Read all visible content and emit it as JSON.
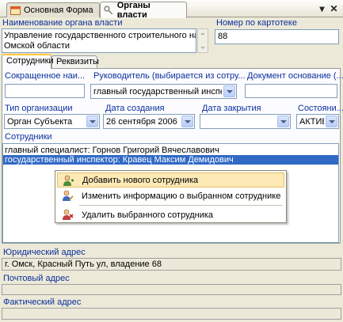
{
  "tabs": [
    {
      "label": "Основная Форма",
      "active": false
    },
    {
      "label": "Органы власти",
      "active": true
    }
  ],
  "window_controls": {
    "dropdown": "▾",
    "close": "✕"
  },
  "org_name": {
    "label": "Наименование органа власти",
    "value_line1": "Управление государственного строительного надзора",
    "value_line2": "Омской области"
  },
  "card_number": {
    "label": "Номер по картотеке",
    "value": "88"
  },
  "inner_tabs": [
    {
      "label": "Сотрудники",
      "active": true
    },
    {
      "label": "Реквизиты",
      "active": false
    }
  ],
  "fields": {
    "short_name": {
      "label": "Сокращенное наи...",
      "value": ""
    },
    "head": {
      "label": "Руководитель  (выбирается  из  сотру...",
      "value": "главный государственный инспекто"
    },
    "document": {
      "label": "Документ  основание (...",
      "value": ""
    },
    "org_type": {
      "label": "Тип организации",
      "value": "Орган Субъекта"
    },
    "created": {
      "label": "Дата создания",
      "value": "26 сентября 2006"
    },
    "closed": {
      "label": "Дата закрытия",
      "value": ""
    },
    "state": {
      "label": "Состояни...",
      "value": "АКТИВІ"
    }
  },
  "employees": {
    "label": "Сотрудники",
    "rows": [
      {
        "text": "главный специалист:  Горнов Григорий Вячеславович",
        "selected": false
      },
      {
        "text": "государственный инспектор:  Кравец Максим Демидович",
        "selected": true
      }
    ]
  },
  "context_menu": {
    "items": [
      {
        "label": "Добавить нового сотрудника",
        "highlighted": true,
        "icon": "add-user-icon"
      },
      {
        "label": "Изменить информацию о выбранном сотруднике",
        "highlighted": false,
        "icon": "edit-user-icon"
      },
      {
        "label": "Удалить выбранного сотрудника",
        "highlighted": false,
        "icon": "delete-user-icon"
      }
    ]
  },
  "addresses": {
    "legal": {
      "label": "Юридический адрес",
      "value": "г. Омск, Красный Путь ул, владение 68"
    },
    "postal": {
      "label": "Почтовый адрес",
      "value": ""
    },
    "actual": {
      "label": "Фактический адрес",
      "value": ""
    }
  },
  "colors": {
    "accent": "#316ac5",
    "label_blue": "#0b2f9e",
    "highlight": "#fce9b6",
    "tab_marker": "#ffc83c"
  }
}
